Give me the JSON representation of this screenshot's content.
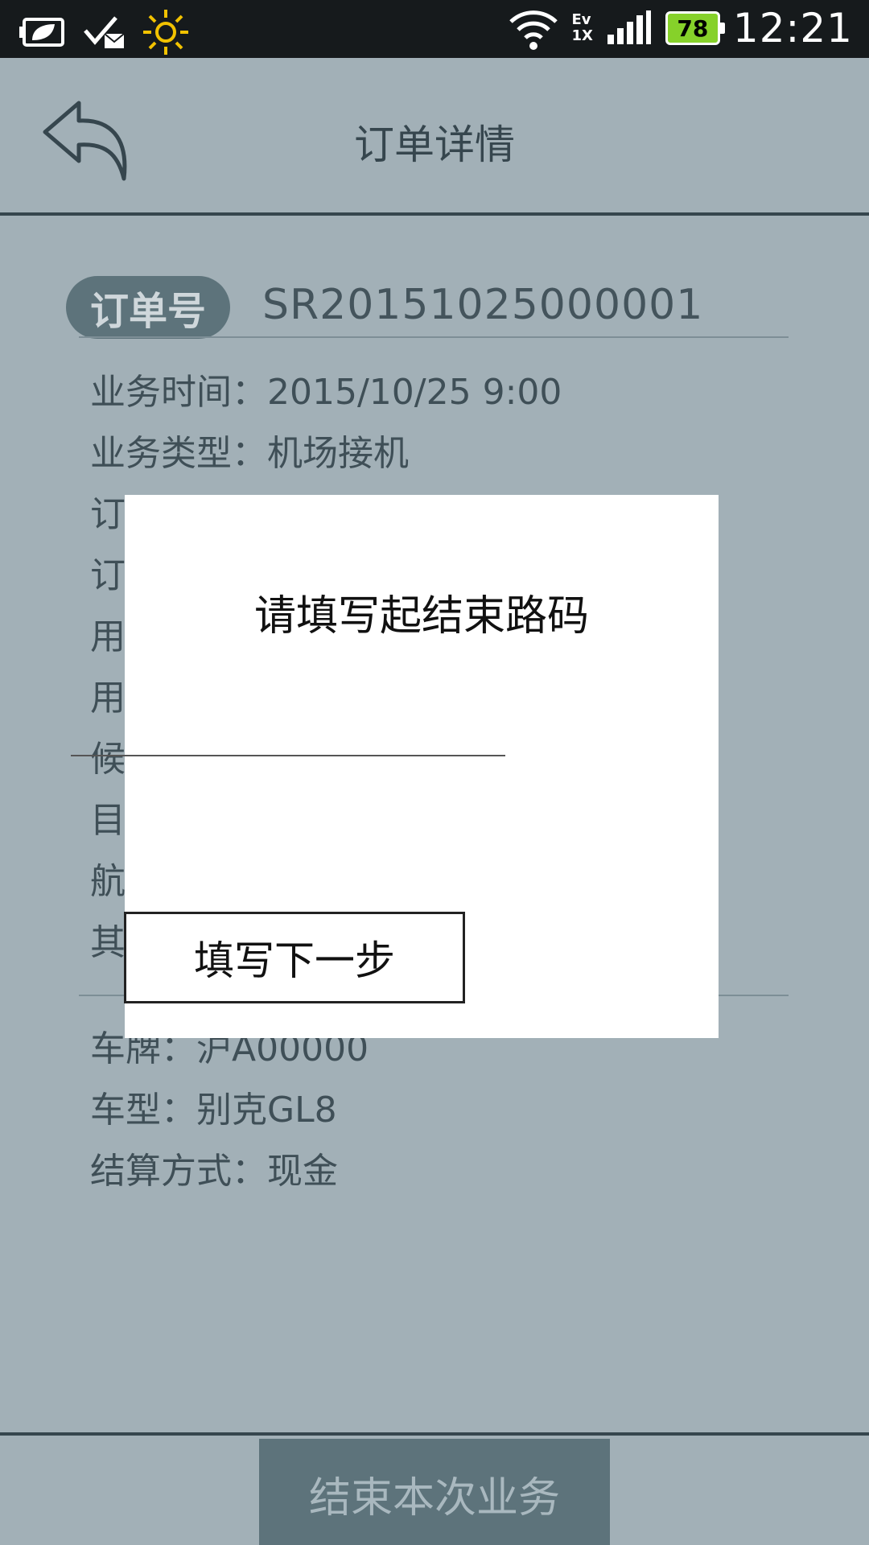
{
  "status_bar": {
    "time": "12:21",
    "battery_level": "78",
    "network_top": "Ev",
    "network_bottom": "1X"
  },
  "header": {
    "title": "订单详情"
  },
  "order": {
    "badge_label": "订单号",
    "number": "SR20151025000001"
  },
  "info": {
    "business_time": "业务时间：2015/10/25  9:00",
    "business_type": "业务类型：机场接机",
    "row3": "订",
    "row4": "订",
    "row5": "用",
    "row6": "用",
    "row7": "候",
    "row8": "目",
    "row9": "航",
    "row10": "其"
  },
  "car": {
    "plate": "车牌：沪A00000",
    "model": "车型：别克GL8",
    "payment": "结算方式：现金"
  },
  "bottom": {
    "finish_label": "结束本次业务"
  },
  "dialog": {
    "title": "请填写起结束路码",
    "input_value": "",
    "button_label": "填写下一步"
  },
  "colors": {
    "background": "#a2b0b7",
    "accent": "#5d737b",
    "battery": "#86d12a"
  }
}
